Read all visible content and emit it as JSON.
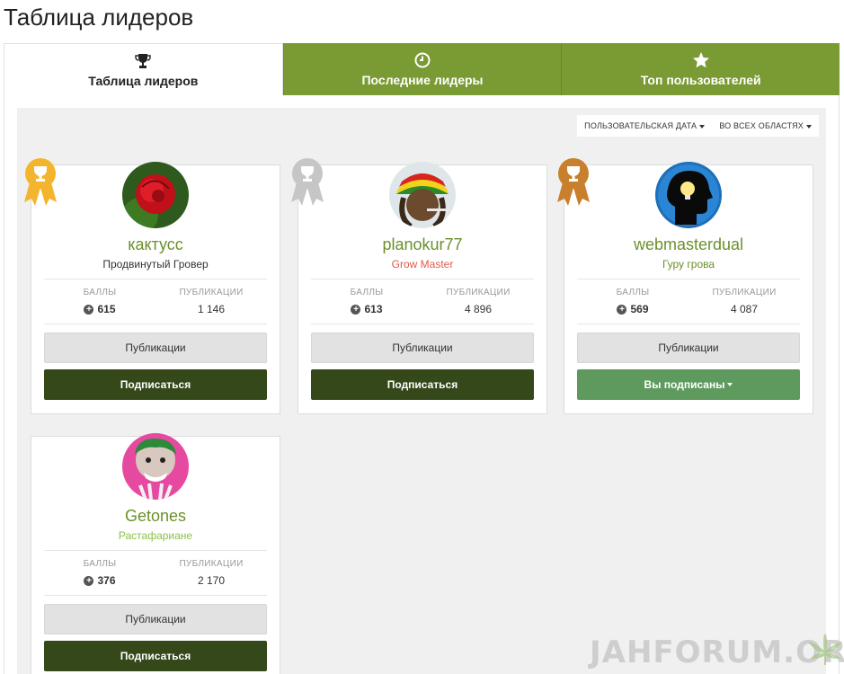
{
  "page": {
    "title": "Таблица лидеров"
  },
  "tabs": [
    {
      "label": "Таблица лидеров",
      "icon": "trophy-icon",
      "active": true
    },
    {
      "label": "Последние лидеры",
      "icon": "clock-icon",
      "active": false
    },
    {
      "label": "Топ пользователей",
      "icon": "star-icon",
      "active": false
    }
  ],
  "filters": {
    "date": "Пользовательская дата",
    "area": "Во всех областях"
  },
  "labels": {
    "points": "Баллы",
    "posts": "Публикации"
  },
  "leaders": [
    {
      "username": "кактусс",
      "rank": "Продвинутый Гровер",
      "rank_color": "#333333",
      "points": "615",
      "posts": "1 146",
      "posts_button": "Публикации",
      "follow_button": "Подписаться",
      "following": false,
      "ribbon": "gold"
    },
    {
      "username": "planokur77",
      "rank": "Grow Master",
      "rank_color": "#e05a4a",
      "points": "613",
      "posts": "4 896",
      "posts_button": "Публикации",
      "follow_button": "Подписаться",
      "following": false,
      "ribbon": "silver"
    },
    {
      "username": "webmasterdual",
      "rank": "Гуру грова",
      "rank_color": "#6d8f2c",
      "points": "569",
      "posts": "4 087",
      "posts_button": "Публикации",
      "follow_button": "Вы подписаны",
      "following": true,
      "ribbon": "bronze"
    },
    {
      "username": "Getones",
      "rank": "Растафариане",
      "rank_color": "#8cc04a",
      "points": "376",
      "posts": "2 170",
      "posts_button": "Публикации",
      "follow_button": "Подписаться",
      "following": false,
      "ribbon": "none"
    }
  ],
  "colors": {
    "tab_green": "#7a9a34",
    "follow_dark": "#35481a",
    "following_green": "#5e9a5e",
    "username_green": "#6d8f2c",
    "gold": "#f4b52e",
    "silver": "#c6c6c6",
    "bronze": "#c9802e"
  },
  "watermark": {
    "text": "JAHFORUM.ORG"
  }
}
